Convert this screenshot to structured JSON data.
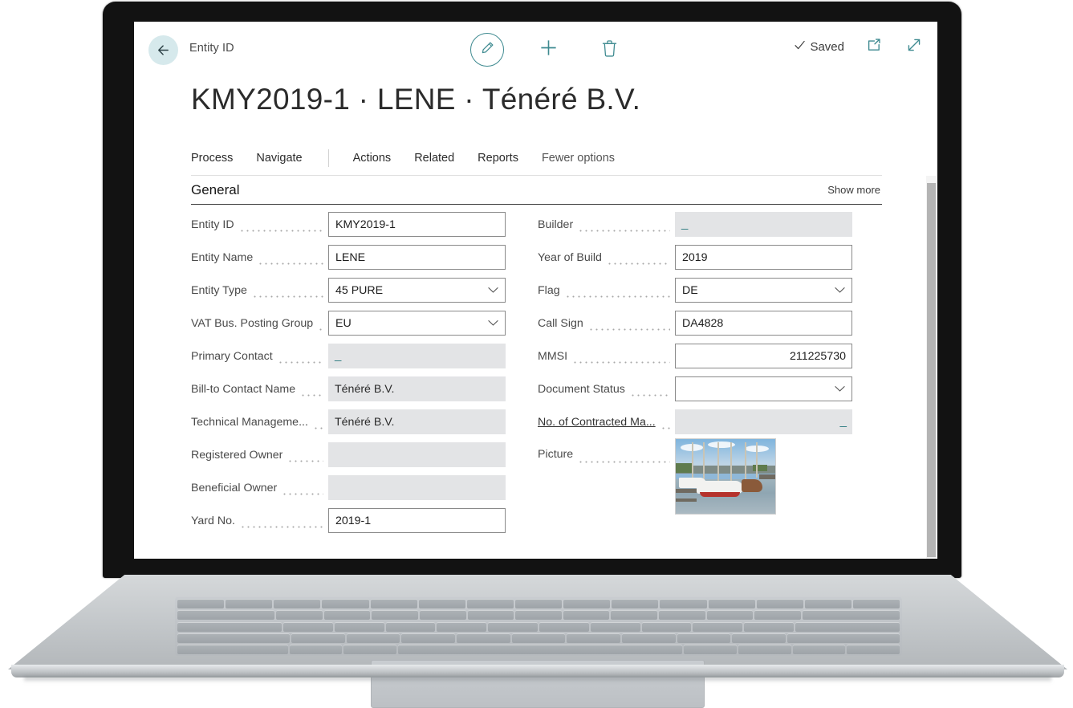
{
  "topbar": {
    "back_icon": "back-arrow-icon",
    "breadcrumb": "Entity ID",
    "edit_icon": "pencil-edit-icon",
    "new_icon": "plus-new-icon",
    "delete_icon": "trash-delete-icon",
    "saved_label": "Saved",
    "saved_check_icon": "checkmark-icon",
    "share_icon": "open-in-new-window-icon",
    "expand_icon": "expand-fullscreen-icon"
  },
  "page": {
    "title": "KMY2019-1 · LENE · Ténéré B.V."
  },
  "ribbon": {
    "items": [
      {
        "label": "Process",
        "muted": false
      },
      {
        "label": "Navigate",
        "muted": false
      },
      {
        "label": "Actions",
        "muted": false
      },
      {
        "label": "Related",
        "muted": false
      },
      {
        "label": "Reports",
        "muted": false
      },
      {
        "label": "Fewer options",
        "muted": true
      }
    ]
  },
  "general": {
    "title": "General",
    "show_more": "Show more"
  },
  "fields_left": [
    {
      "label": "Entity ID",
      "value": "KMY2019-1",
      "type": "text"
    },
    {
      "label": "Entity Name",
      "value": "LENE",
      "type": "text"
    },
    {
      "label": "Entity Type",
      "value": "45 PURE",
      "type": "select"
    },
    {
      "label": "VAT Bus. Posting Group",
      "value": "EU",
      "type": "select"
    },
    {
      "label": "Primary Contact",
      "value": "_",
      "type": "readonly-dash"
    },
    {
      "label": "Bill-to Contact Name",
      "value": "Ténéré B.V.",
      "type": "readonly"
    },
    {
      "label": "Technical Manageme...",
      "value": "Ténéré B.V.",
      "type": "readonly"
    },
    {
      "label": "Registered Owner",
      "value": "",
      "type": "readonly"
    },
    {
      "label": "Beneficial Owner",
      "value": "",
      "type": "readonly"
    },
    {
      "label": "Yard No.",
      "value": "2019-1",
      "type": "text"
    }
  ],
  "fields_right": [
    {
      "label": "Builder",
      "value": "_",
      "type": "readonly-dash"
    },
    {
      "label": "Year of Build",
      "value": "2019",
      "type": "text"
    },
    {
      "label": "Flag",
      "value": "DE",
      "type": "select"
    },
    {
      "label": "Call Sign",
      "value": "DA4828",
      "type": "text"
    },
    {
      "label": "MMSI",
      "value": "211225730",
      "type": "number"
    },
    {
      "label": "Document Status",
      "value": "",
      "type": "select"
    },
    {
      "label": "No. of Contracted Ma...",
      "value": "_",
      "type": "readonly-dash-right",
      "link": true
    },
    {
      "label": "Picture",
      "value": "",
      "type": "picture"
    }
  ],
  "scrollbar": {
    "name": "vertical-scrollbar"
  },
  "colors": {
    "accent_teal": "#3e8a90",
    "back_circle": "#d6e9ec",
    "readonly_bg": "#e3e4e6",
    "field_border": "#8a8a8a"
  }
}
